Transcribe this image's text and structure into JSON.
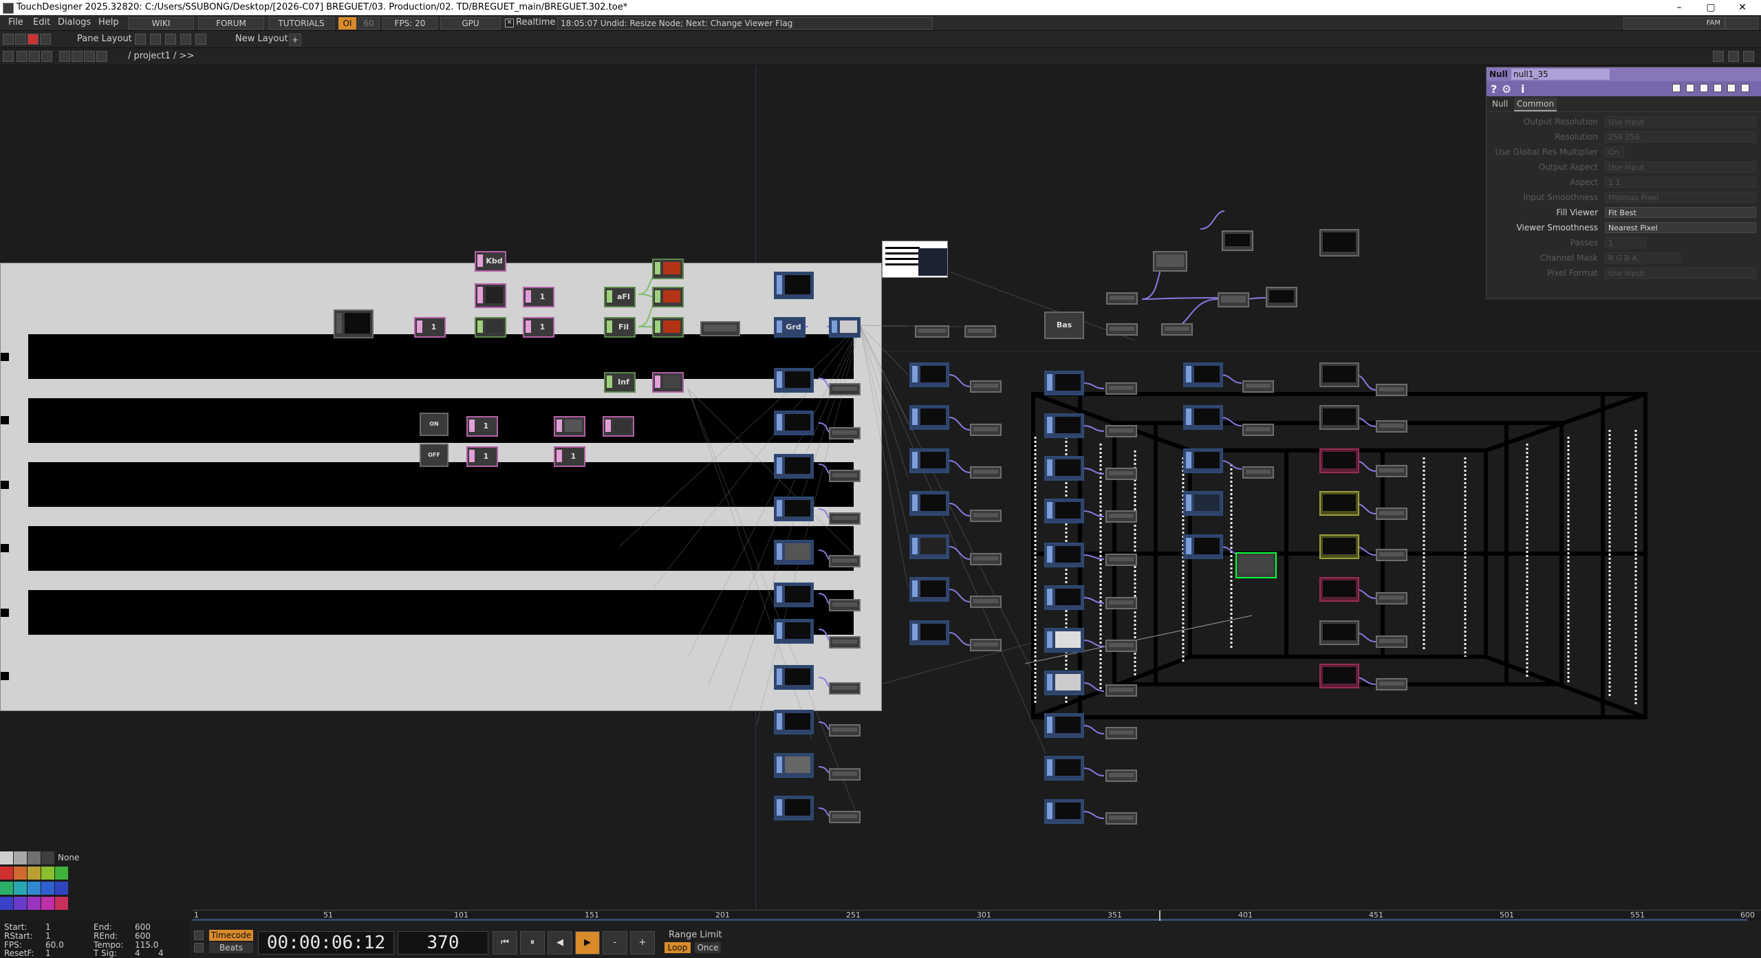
{
  "titlebar": {
    "title": "TouchDesigner 2025.32820: C:/Users/SSUBONG/Desktop/[2026-C07] BREGUET/03. Production/02. TD/BREGUET_main/BREGUET.302.toe*",
    "minimize": "–",
    "maximize": "▢",
    "close": "✕"
  },
  "menubar": {
    "items": [
      "File",
      "Edit",
      "Dialogs",
      "Help"
    ],
    "wiki": "WIKI",
    "forum": "FORUM",
    "tutorials": "TUTORIALS",
    "oi": "OI",
    "sixty": "60",
    "fps": "FPS: 20",
    "gpu": "GPU",
    "realtime_check": "✕",
    "realtime": "Realtime",
    "status": "18:05:07 Undid: Resize Node; Next: Change Viewer Flag",
    "perf": "FAM"
  },
  "panebar": {
    "pane_layout": "Pane Layout",
    "new_layout": "New Layout",
    "add": "+"
  },
  "pathbar": {
    "path": "/ project1 / >>"
  },
  "nodes": {
    "kbd": "Kbd",
    "afi": "aFI",
    "fil": "Fil",
    "grd": "Grd",
    "inf": "Inf",
    "bas": "Bas",
    "on": "ON",
    "off": "OFF",
    "one": "1"
  },
  "param": {
    "type": "Null",
    "name": "null1_35",
    "icons": [
      "?",
      "⚙",
      "i"
    ],
    "tabs": [
      "Null",
      "Common"
    ],
    "rows": [
      {
        "label": "Output Resolution",
        "value": "Use Input"
      },
      {
        "label": "Resolution",
        "value": "256                 256"
      },
      {
        "label": "Use Global Res Multiplier",
        "value": "On"
      },
      {
        "label": "Output Aspect",
        "value": "Use Input"
      },
      {
        "label": "Aspect",
        "value": "1                   1"
      },
      {
        "label": "Input Smoothness",
        "value": "Mipmap Pixel"
      },
      {
        "label": "Fill Viewer",
        "value": "Fit Best"
      },
      {
        "label": "Viewer Smoothness",
        "value": "Nearest Pixel"
      },
      {
        "label": "Passes",
        "value": "1"
      },
      {
        "label": "Channel Mask",
        "value": "R  G  B  A"
      },
      {
        "label": "Pixel Format",
        "value": "Use Input"
      }
    ]
  },
  "palette": {
    "none": "None"
  },
  "timeline": {
    "ticks": [
      "1",
      "51",
      "101",
      "151",
      "201",
      "251",
      "301",
      "351",
      "401",
      "451",
      "501",
      "551",
      "600"
    ]
  },
  "transport": {
    "start_label": "Start:",
    "start": "1",
    "end_label": "End:",
    "end": "600",
    "rstart_label": "RStart:",
    "rstart": "1",
    "rend_label": "REnd:",
    "rend": "600",
    "fps_label": "FPS:",
    "fps": "60.0",
    "tempo_label": "Tempo:",
    "tempo": "115.0",
    "resetf_label": "ResetF:",
    "resetf": "1",
    "tsig_label": "T Sig:",
    "tsig_a": "4",
    "tsig_b": "4",
    "timecode": "Timecode",
    "beats": "Beats",
    "time": "00:00:06:12",
    "frame": "370",
    "range_limit": "Range Limit",
    "loop": "Loop",
    "once": "Once",
    "btn_rewind": "⏮",
    "btn_pause": "⏸",
    "btn_back": "◀",
    "btn_play": "▶",
    "btn_minus": "-",
    "btn_plus": "+"
  },
  "colors": {
    "accent_orange": "#d98b2b",
    "null_header": "#8c7bc0",
    "selected_node": "#00ff3a"
  }
}
